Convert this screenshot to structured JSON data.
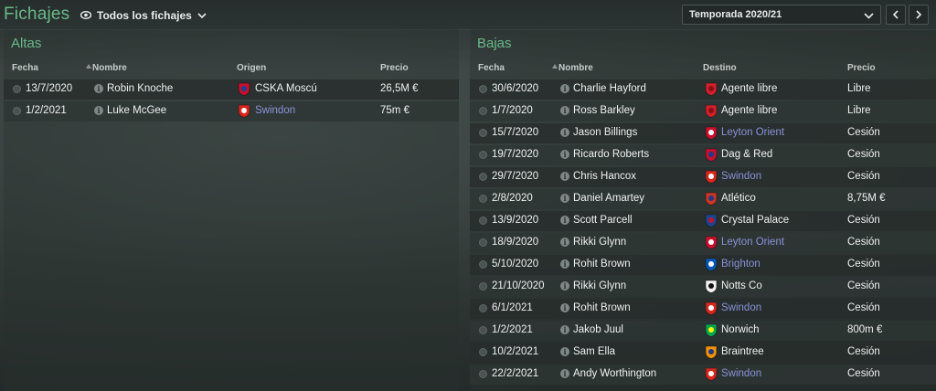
{
  "header": {
    "title": "Fichajes",
    "filter_label": "Todos los fichajes",
    "season_label": "Temporada 2020/21"
  },
  "altas": {
    "title": "Altas",
    "columns": {
      "fecha": "Fecha",
      "nombre": "Nombre",
      "origen": "Origen",
      "precio": "Precio"
    },
    "rows": [
      {
        "fecha": "13/7/2020",
        "nombre": "Robin Knoche",
        "club": "CSKA Moscú",
        "club_link": false,
        "crest": "cska-crest",
        "precio": "26,5M €"
      },
      {
        "fecha": "1/2/2021",
        "nombre": "Luke McGee",
        "club": "Swindon",
        "club_link": true,
        "crest": "swindon-crest",
        "precio": "75m €"
      }
    ]
  },
  "bajas": {
    "title": "Bajas",
    "columns": {
      "fecha": "Fecha",
      "nombre": "Nombre",
      "destino": "Destino",
      "precio": "Precio"
    },
    "rows": [
      {
        "fecha": "30/6/2020",
        "nombre": "Charlie Hayford",
        "club": "Agente libre",
        "club_link": false,
        "crest": "free-agent-icon",
        "precio": "Libre"
      },
      {
        "fecha": "1/7/2020",
        "nombre": "Ross Barkley",
        "club": "Agente libre",
        "club_link": false,
        "crest": "free-agent-icon",
        "precio": "Libre"
      },
      {
        "fecha": "15/7/2020",
        "nombre": "Jason Billings",
        "club": "Leyton Orient",
        "club_link": true,
        "crest": "leyton-orient-crest",
        "precio": "Cesión"
      },
      {
        "fecha": "19/7/2020",
        "nombre": "Ricardo Roberts",
        "club": "Dag & Red",
        "club_link": false,
        "crest": "dag-red-crest",
        "precio": "Cesión"
      },
      {
        "fecha": "29/7/2020",
        "nombre": "Chris Hancox",
        "club": "Swindon",
        "club_link": true,
        "crest": "swindon-crest",
        "precio": "Cesión"
      },
      {
        "fecha": "2/8/2020",
        "nombre": "Daniel Amartey",
        "club": "Atlético",
        "club_link": false,
        "crest": "atletico-crest",
        "precio": "8,75M €"
      },
      {
        "fecha": "13/9/2020",
        "nombre": "Scott Parcell",
        "club": "Crystal Palace",
        "club_link": false,
        "crest": "crystal-palace-crest",
        "precio": "Cesión"
      },
      {
        "fecha": "18/9/2020",
        "nombre": "Rikki Glynn",
        "club": "Leyton Orient",
        "club_link": true,
        "crest": "leyton-orient-crest",
        "precio": "Cesión"
      },
      {
        "fecha": "5/10/2020",
        "nombre": "Rohit Brown",
        "club": "Brighton",
        "club_link": true,
        "crest": "brighton-crest",
        "precio": "Cesión"
      },
      {
        "fecha": "21/10/2020",
        "nombre": "Rikki Glynn",
        "club": "Notts Co",
        "club_link": false,
        "crest": "notts-co-crest",
        "precio": "Cesión"
      },
      {
        "fecha": "6/1/2021",
        "nombre": "Rohit Brown",
        "club": "Swindon",
        "club_link": true,
        "crest": "swindon-crest",
        "precio": "Cesión"
      },
      {
        "fecha": "1/2/2021",
        "nombre": "Jakob Juul",
        "club": "Norwich",
        "club_link": false,
        "crest": "norwich-crest",
        "precio": "800m €"
      },
      {
        "fecha": "10/2/2021",
        "nombre": "Sam Ella",
        "club": "Braintree",
        "club_link": false,
        "crest": "braintree-crest",
        "precio": "Cesión"
      },
      {
        "fecha": "22/2/2021",
        "nombre": "Andy Worthington",
        "club": "Swindon",
        "club_link": true,
        "crest": "swindon-crest",
        "precio": "Cesión"
      }
    ]
  },
  "colors": {
    "accent_green": "#69b98a",
    "link_purple": "#8a92d8"
  },
  "crest_colors": {
    "cska-crest": [
      "#c8102e",
      "#1c3f94"
    ],
    "swindon-crest": [
      "#d8261c",
      "#ffffff"
    ],
    "free-agent-icon": [
      "#d0202a",
      "#8a0f15"
    ],
    "leyton-orient-crest": [
      "#c8102e",
      "#ffffff"
    ],
    "dag-red-crest": [
      "#c8102e",
      "#1b3b8a"
    ],
    "atletico-crest": [
      "#cb3524",
      "#1f3a8a"
    ],
    "crystal-palace-crest": [
      "#1b458f",
      "#c4122e"
    ],
    "brighton-crest": [
      "#0057b8",
      "#ffffff"
    ],
    "notts-co-crest": [
      "#f2f2f2",
      "#111111"
    ],
    "norwich-crest": [
      "#00a650",
      "#fff200"
    ],
    "braintree-crest": [
      "#f39200",
      "#1b3b8a"
    ]
  }
}
